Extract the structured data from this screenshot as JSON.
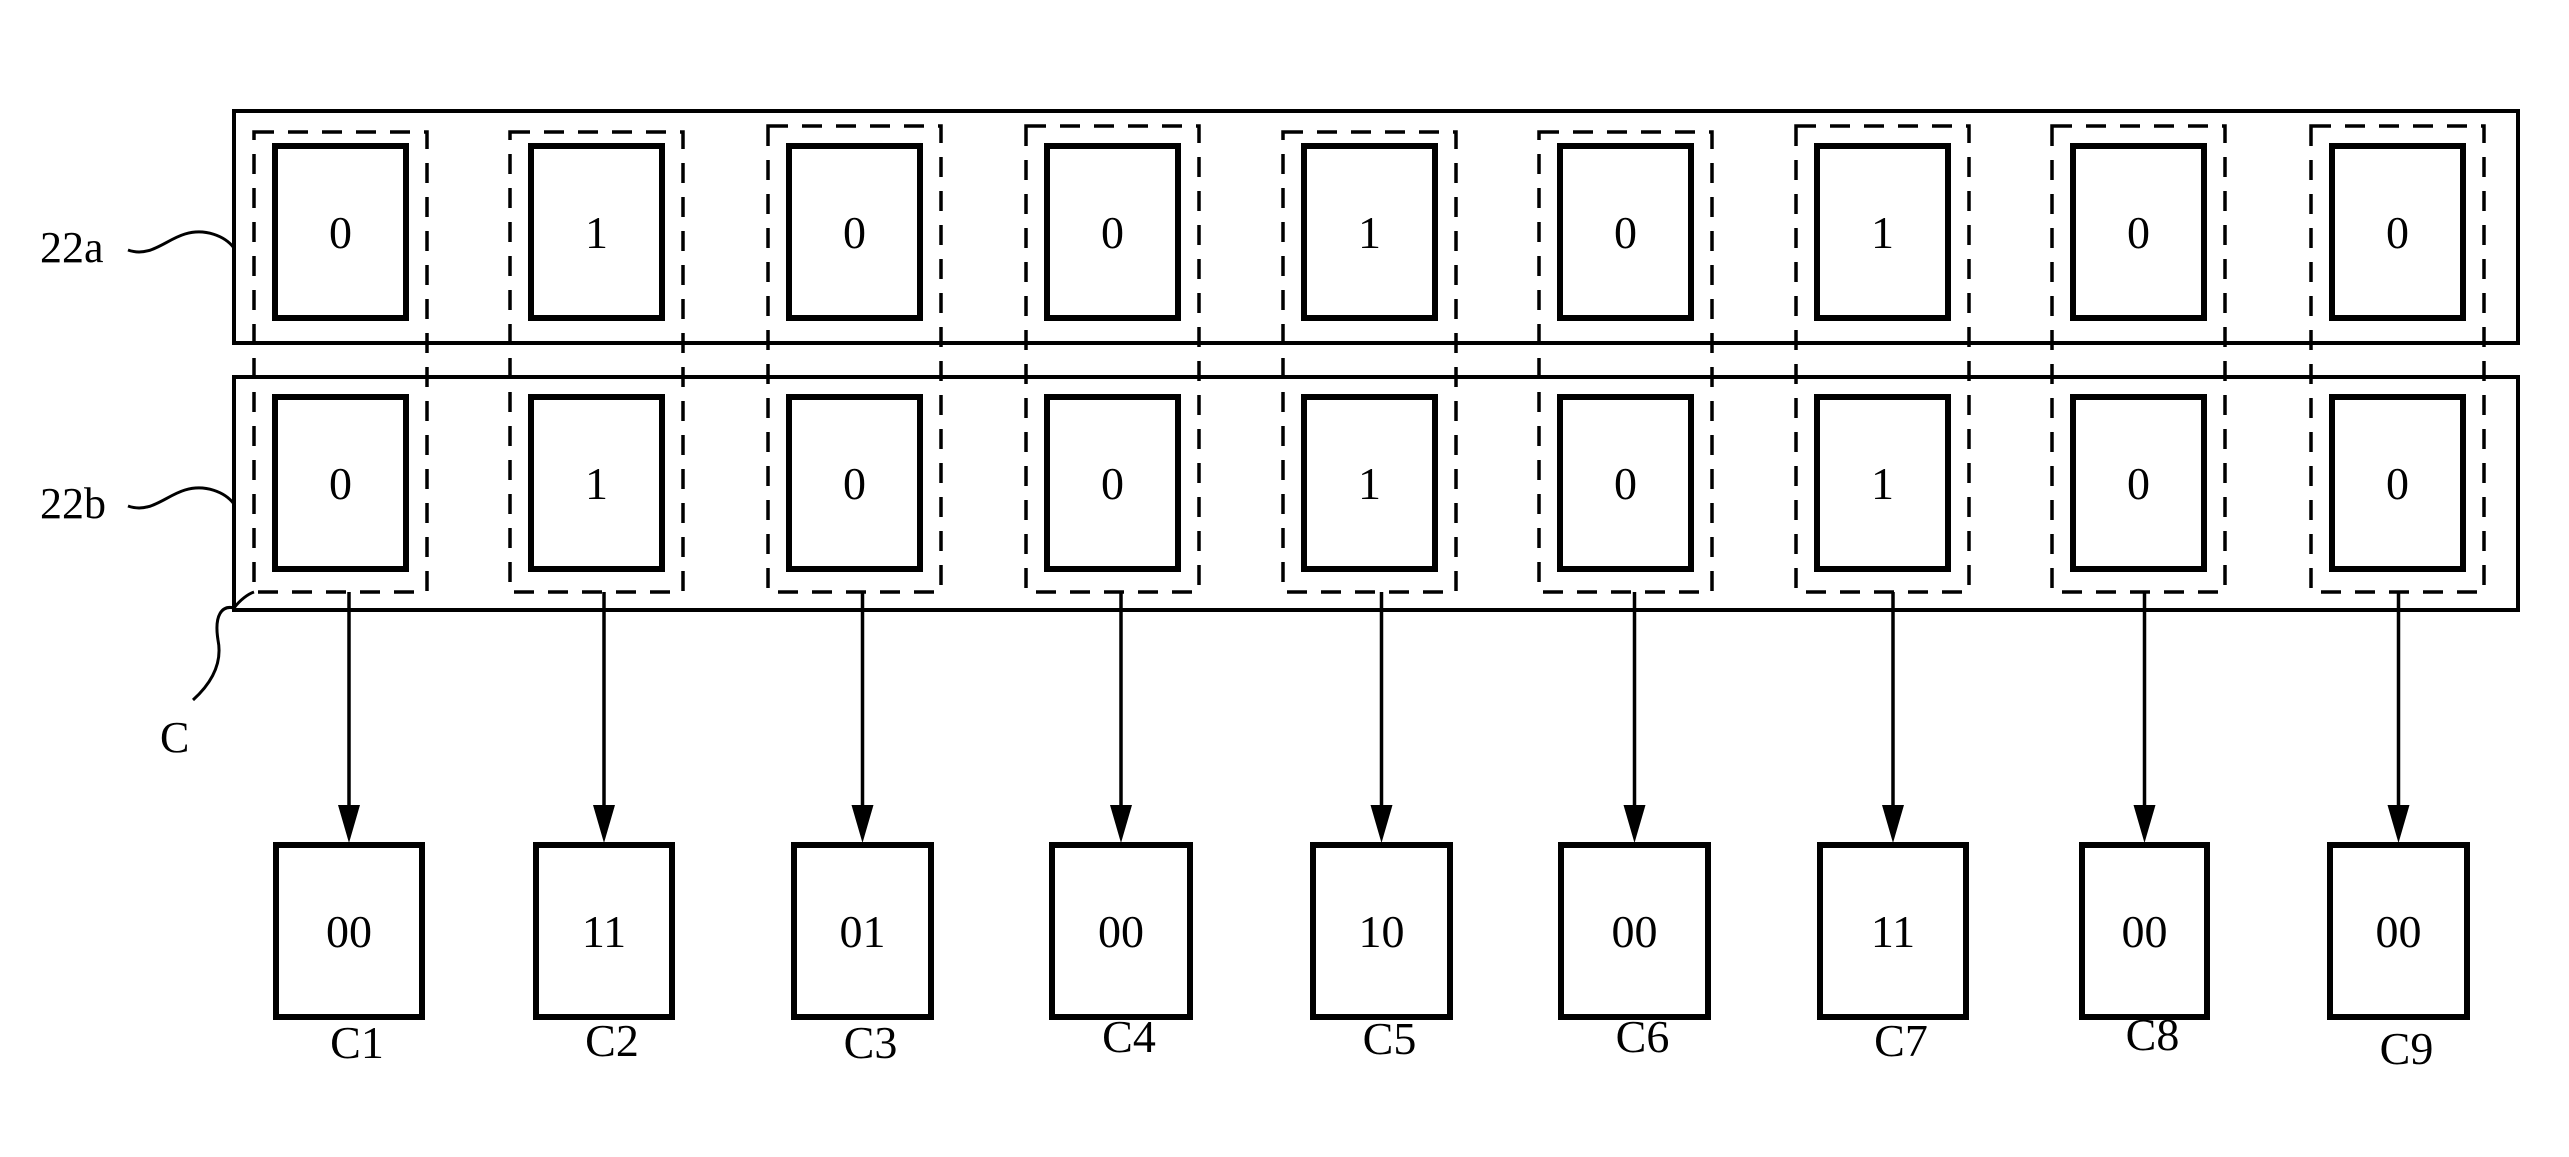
{
  "figure": {
    "rows": [
      {
        "ref": "22a",
        "bits": [
          "0",
          "1",
          "0",
          "0",
          "1",
          "0",
          "1",
          "0",
          "0"
        ]
      },
      {
        "ref": "22b",
        "bits": [
          "0",
          "1",
          "0",
          "0",
          "1",
          "0",
          "1",
          "0",
          "0"
        ]
      }
    ],
    "column_group_ref": "C",
    "outputs": [
      {
        "label": "C1",
        "value": "00"
      },
      {
        "label": "C2",
        "value": "11"
      },
      {
        "label": "C3",
        "value": "01"
      },
      {
        "label": "C4",
        "value": "00"
      },
      {
        "label": "C5",
        "value": "10"
      },
      {
        "label": "C6",
        "value": "00"
      },
      {
        "label": "C7",
        "value": "11"
      },
      {
        "label": "C8",
        "value": "00"
      },
      {
        "label": "C9",
        "value": "00"
      }
    ],
    "colors": {
      "line": "#000000",
      "background": "#ffffff"
    }
  }
}
